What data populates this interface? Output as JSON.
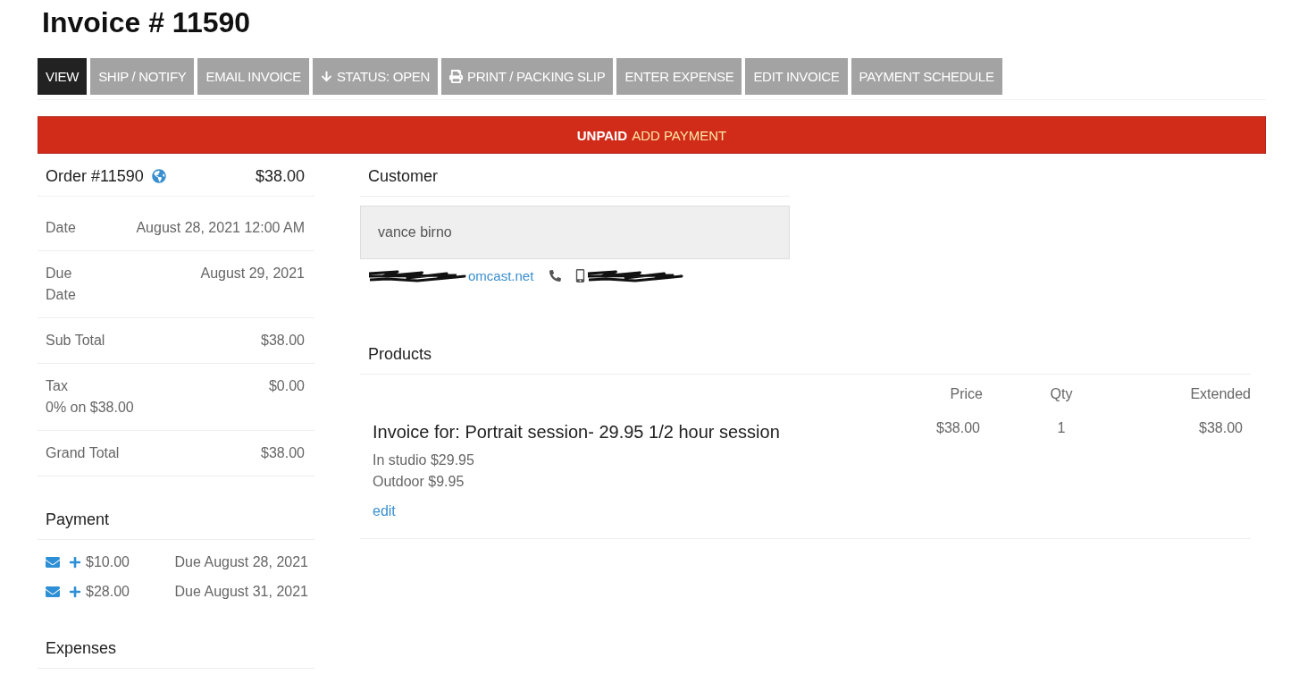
{
  "title": "Invoice # 11590",
  "toolbar": [
    {
      "label": "VIEW",
      "selected": true,
      "kind": "plain"
    },
    {
      "label": "SHIP / NOTIFY",
      "selected": false,
      "kind": "plain"
    },
    {
      "label": "EMAIL INVOICE",
      "selected": false,
      "kind": "plain"
    },
    {
      "label": "STATUS: OPEN",
      "selected": false,
      "kind": "status"
    },
    {
      "label": "PRINT / PACKING SLIP",
      "selected": false,
      "kind": "print"
    },
    {
      "label": "ENTER EXPENSE",
      "selected": false,
      "kind": "plain"
    },
    {
      "label": "EDIT INVOICE",
      "selected": false,
      "kind": "plain"
    },
    {
      "label": "PAYMENT SCHEDULE",
      "selected": false,
      "kind": "plain"
    }
  ],
  "banner": {
    "status": "UNPAID",
    "action": "ADD PAYMENT"
  },
  "order": {
    "number": "Order #11590",
    "total": "$38.00",
    "rows": [
      {
        "label": "Date",
        "value": "August 28, 2021 12:00 AM"
      },
      {
        "label": "Due\nDate",
        "value": "August 29, 2021"
      },
      {
        "label": "Sub Total",
        "value": "$38.00"
      },
      {
        "label": "Tax",
        "note": "0% on $38.00",
        "value": "$0.00"
      },
      {
        "label": "Grand Total",
        "value": "$38.00"
      }
    ]
  },
  "payment": {
    "heading": "Payment",
    "items": [
      {
        "amount": "$10.00",
        "due": "Due August 28, 2021"
      },
      {
        "amount": "$28.00",
        "due": "Due August 31, 2021"
      }
    ]
  },
  "expenses": {
    "heading": "Expenses"
  },
  "customer": {
    "heading": "Customer",
    "name": "vance birno",
    "email": "omcast.net"
  },
  "products": {
    "heading": "Products",
    "columns": [
      "Price",
      "Qty",
      "Extended"
    ],
    "items": [
      {
        "title": "Invoice for: Portrait session- 29.95 1/2 hour session",
        "options": [
          "In studio $29.95",
          "Outdoor $9.95"
        ],
        "link": "edit",
        "price": "$38.00",
        "qty": "1",
        "extended": "$38.00"
      }
    ]
  }
}
